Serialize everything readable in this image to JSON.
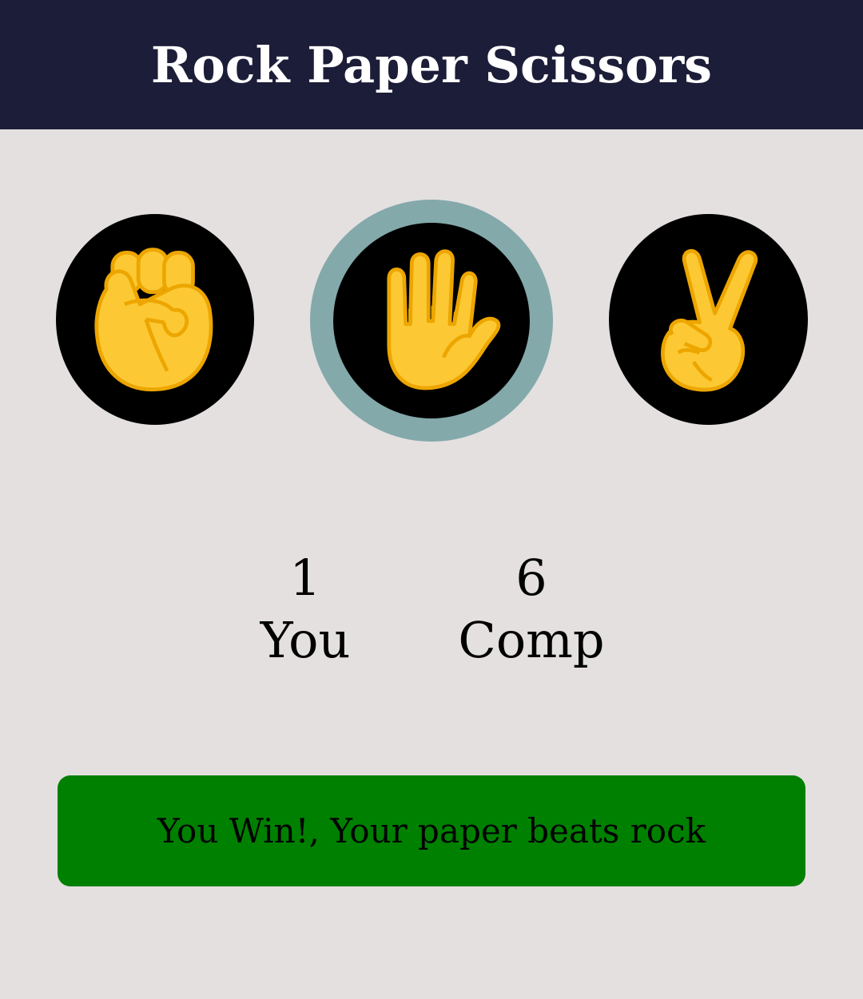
{
  "header": {
    "title": "Rock Paper Scissors"
  },
  "choices": [
    {
      "name": "rock",
      "icon": "raised-fist-icon",
      "selected": false
    },
    {
      "name": "paper",
      "icon": "raised-hand-icon",
      "selected": true
    },
    {
      "name": "scissors",
      "icon": "victory-hand-icon",
      "selected": false
    }
  ],
  "score": {
    "you_value": "1",
    "you_label": "You",
    "comp_value": "6",
    "comp_label": "Comp"
  },
  "result": {
    "message": "You Win!, Your paper beats rock"
  },
  "colors": {
    "header_bg": "#1c1d38",
    "page_bg": "#e4e0e0",
    "selected_ring": "#84a9aa",
    "result_bg": "#008000",
    "emoji_yellow": "#fcc934",
    "emoji_shade": "#eda600"
  }
}
